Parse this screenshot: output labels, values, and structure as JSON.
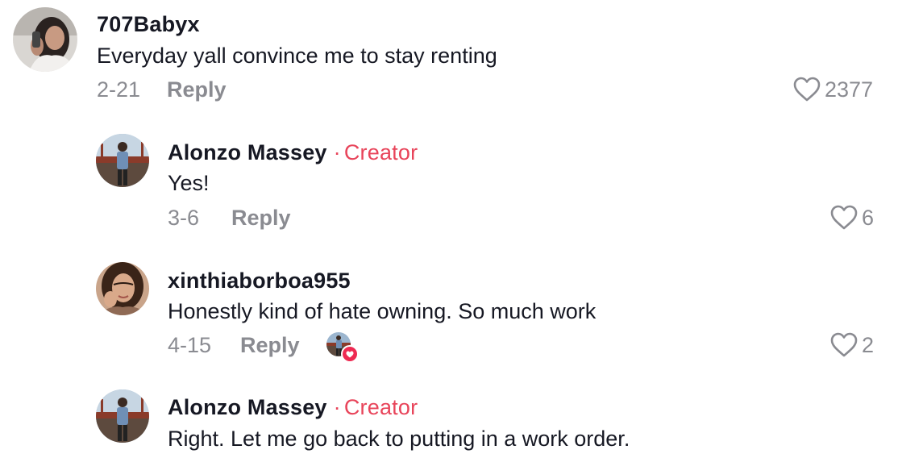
{
  "comments": [
    {
      "username": "707Babyx",
      "text": "Everyday yall convince me to stay renting",
      "date": "2-21",
      "reply_label": "Reply",
      "likes": "2377"
    },
    {
      "username": "Alonzo Massey",
      "creator_dot": "·",
      "creator_label": "Creator",
      "text": "Yes!",
      "date": "3-6",
      "reply_label": "Reply",
      "likes": "6"
    },
    {
      "username": "xinthiaborboa955",
      "text": "Honestly kind of hate owning. So much work",
      "date": "4-15",
      "reply_label": "Reply",
      "likes": "2",
      "liked_by_creator": true
    },
    {
      "username": "Alonzo Massey",
      "creator_dot": "·",
      "creator_label": "Creator",
      "text": "Right. Let me go back to putting in a work order."
    }
  ],
  "colors": {
    "creator": "#e8445a",
    "muted": "#8a8b91",
    "text": "#161823",
    "heart_badge": "#ee2a52"
  },
  "icons": {
    "like": "heart-outline-icon",
    "creator_like_badge": "heart-filled-icon"
  }
}
